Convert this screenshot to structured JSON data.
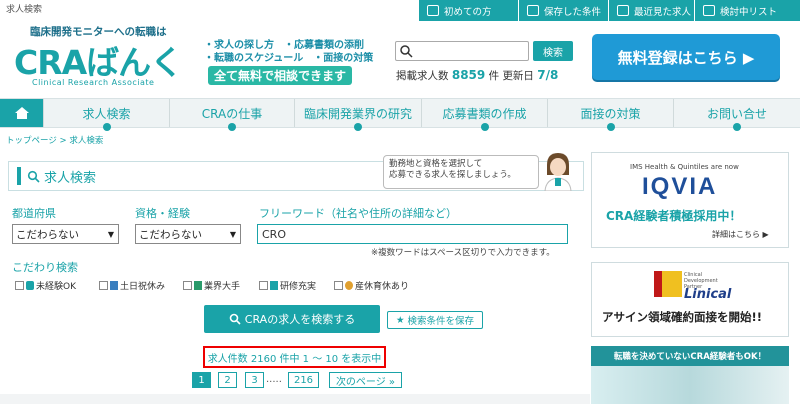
{
  "top_label": "求人検索",
  "top_nav": [
    {
      "label": "初めての方",
      "icon": "person-icon"
    },
    {
      "label": "保存した条件",
      "icon": "save-icon"
    },
    {
      "label": "最近見た求人",
      "icon": "history-icon"
    },
    {
      "label": "検討中リスト",
      "icon": "list-icon"
    }
  ],
  "logo": {
    "subtitle": "臨床開発モニターへの転職は",
    "name": "CRAばんく",
    "english": "Clinical Research Associate"
  },
  "taglines": [
    "・求人の探し方　・応募書類の添削",
    "・転職のスケジュール　・面接の対策"
  ],
  "tagline_box": "全て無料で相談できます",
  "search": {
    "placeholder": "",
    "button": "検索"
  },
  "stats": {
    "prefix": "掲載求人数",
    "count": "8859",
    "unit": "件",
    "updated_label": "更新日",
    "updated": "7/8"
  },
  "register_button": "無料登録はこちら ▶",
  "main_nav": [
    "求人検索",
    "CRAの仕事",
    "臨床開発業界の研究",
    "応募書類の作成",
    "面接の対策",
    "お問い合せ"
  ],
  "breadcrumb": "トップページ > 求人検索",
  "panel": {
    "title": "求人検索",
    "bubble": "勤務地と資格を選択して\n応募できる求人を探しましょう。",
    "pref_label": "都道府県",
    "pref_value": "こだわらない",
    "qual_label": "資格・経験",
    "qual_value": "こだわらない",
    "free_label": "フリーワード（社名や住所の詳細など）",
    "free_value": "CRO",
    "note": "※複数ワードはスペース区切りで入力できます。",
    "kodawari_label": "こだわり検索",
    "checkboxes": [
      "未経験OK",
      "土日祝休み",
      "業界大手",
      "研修充実",
      "産休育休あり"
    ],
    "search_button": "CRAの求人を検索する",
    "save_button": "検索条件を保存",
    "result_count": "求人件数 2160 件中 1 〜 10 を表示中"
  },
  "pagination": {
    "pages": [
      "1",
      "2",
      "3"
    ],
    "ellipsis": ".....",
    "last": "216",
    "next": "次のページ »"
  },
  "ads": {
    "iqvia_top": "IMS Health & Quintiles are now",
    "iqvia_logo": "IQVIA",
    "iqvia_main": "CRA経験者積極採用中！",
    "iqvia_link": "詳細はこちら ▶",
    "linical_small": "Clinical Development Partner",
    "linical_logo": "Linical",
    "linical_main": "アサイン領域確約面接を開始!!",
    "banner3": "転職を決めていないCRA経験者もOK！"
  }
}
